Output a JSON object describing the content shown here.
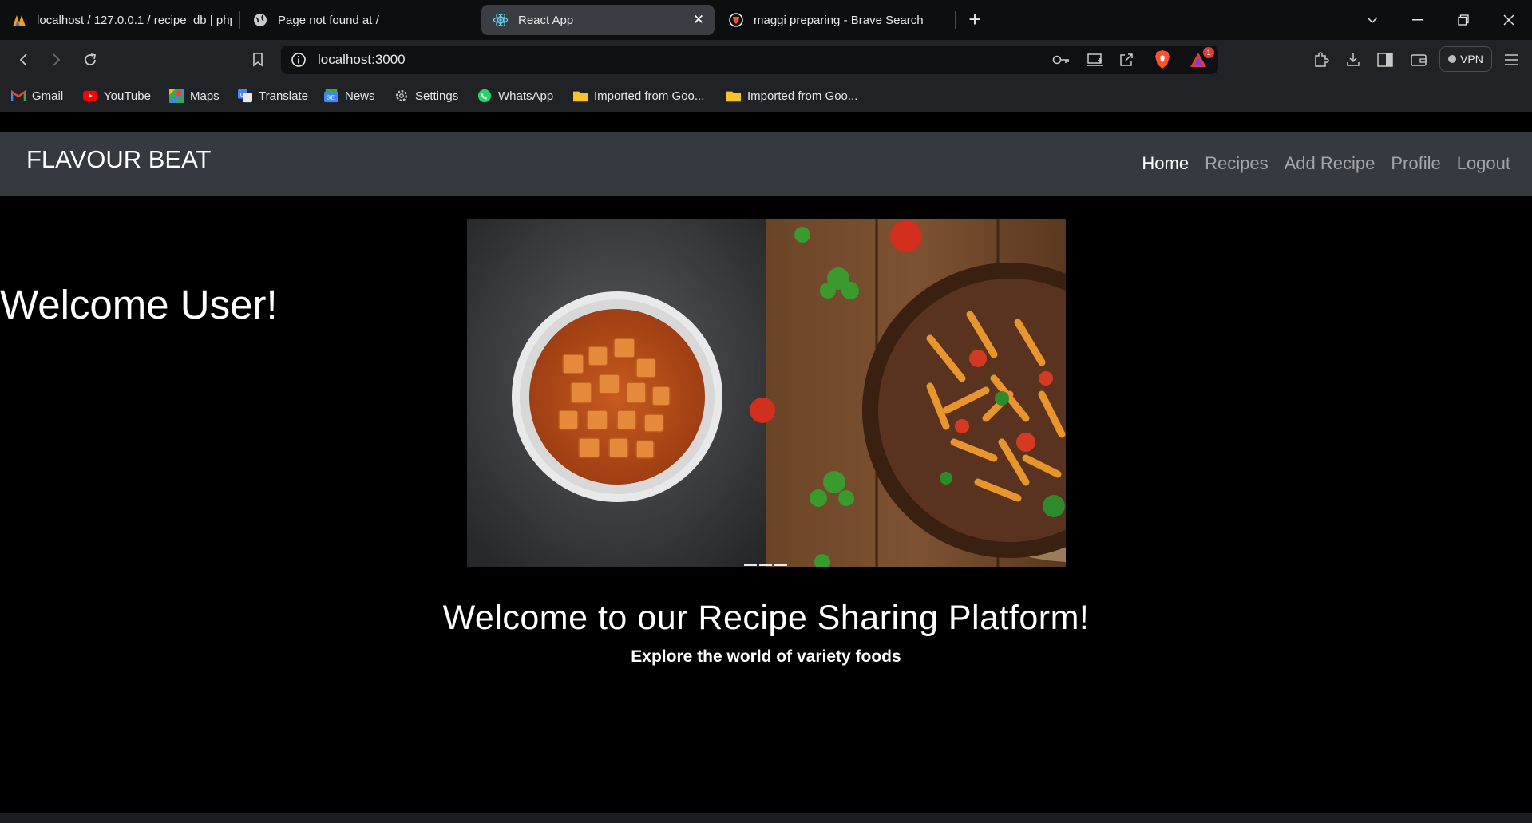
{
  "browser": {
    "tabs": [
      {
        "title": "localhost / 127.0.0.1 / recipe_db | php",
        "icon": "phpmyadmin-icon"
      },
      {
        "title": "Page not found at /",
        "icon": "globe-icon"
      },
      {
        "title": "React App",
        "icon": "react-icon",
        "active": true
      },
      {
        "title": "maggi preparing - Brave Search",
        "icon": "brave-search-icon"
      }
    ],
    "url": "localhost:3000",
    "vpn_label": "VPN",
    "notification_count": "1",
    "bookmarks": [
      {
        "label": "Gmail",
        "icon": "gmail-icon"
      },
      {
        "label": "YouTube",
        "icon": "youtube-icon"
      },
      {
        "label": "Maps",
        "icon": "maps-icon"
      },
      {
        "label": "Translate",
        "icon": "translate-icon"
      },
      {
        "label": "News",
        "icon": "news-icon"
      },
      {
        "label": "Settings",
        "icon": "settings-icon"
      },
      {
        "label": "WhatsApp",
        "icon": "whatsapp-icon"
      },
      {
        "label": "Imported from Goo...",
        "icon": "folder-icon"
      },
      {
        "label": "Imported from Goo...",
        "icon": "folder-icon"
      }
    ]
  },
  "app": {
    "brand": "FLAVOUR BEAT",
    "nav": [
      "Home",
      "Recipes",
      "Add Recipe",
      "Profile",
      "Logout"
    ],
    "nav_active": "Home",
    "welcome": "Welcome User!",
    "heading": "Welcome to our Recipe Sharing Platform!",
    "subheading": "Explore the world of variety foods",
    "carousel_slide_count": 3
  },
  "colors": {
    "navbar": "#343a40",
    "page_bg": "#000000",
    "browser_chrome": "#202226"
  }
}
